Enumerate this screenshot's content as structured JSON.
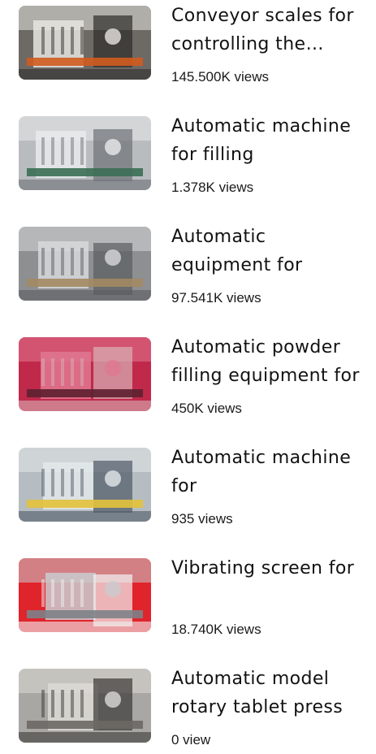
{
  "videos": [
    {
      "title": "Conveyor scales for controlling the weight",
      "views": "145.500K views",
      "thumb_colors": [
        "#6d6a66",
        "#e7e5e0",
        "#d25b1e",
        "#2f2d2b"
      ]
    },
    {
      "title": "Automatic machine for filling",
      "views": "1.378K views",
      "thumb_colors": [
        "#b9bcbf",
        "#e9eaeb",
        "#3b6e54",
        "#6d7278"
      ]
    },
    {
      "title": "Automatic equipment for",
      "views": "97.541K views",
      "thumb_colors": [
        "#8d8f91",
        "#d7d9db",
        "#a38a63",
        "#5a5c5f"
      ]
    },
    {
      "title": "Automatic powder filling equipment for",
      "views": "450K views",
      "thumb_colors": [
        "#c0294a",
        "#e07890",
        "#5c2030",
        "#d9b0b8"
      ]
    },
    {
      "title": "Automatic machine for",
      "views": "935 views",
      "thumb_colors": [
        "#b5bcc2",
        "#e3e7ea",
        "#e3c23a",
        "#4f5a66"
      ]
    },
    {
      "title": "Vibrating screen for",
      "views": "18.740K views",
      "thumb_colors": [
        "#e0242c",
        "#c9ccd0",
        "#7d8288",
        "#f2f2f2"
      ]
    },
    {
      "title": "Automatic model rotary tablet press",
      "views": "0 view",
      "thumb_colors": [
        "#a9a7a3",
        "#dcdad6",
        "#6b6865",
        "#3a3836"
      ]
    }
  ]
}
